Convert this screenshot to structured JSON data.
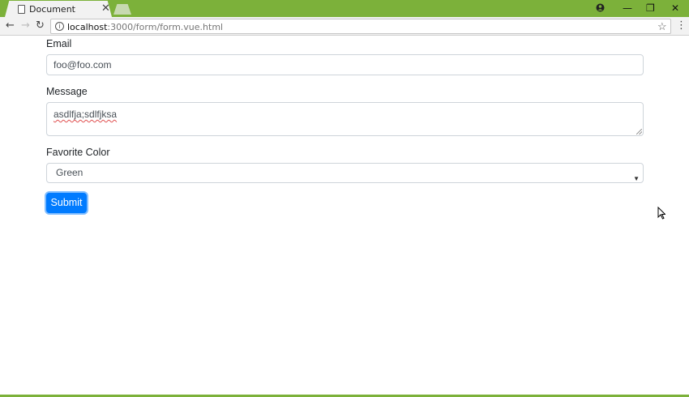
{
  "browser": {
    "tab_title": "Document",
    "tab_close": "✕",
    "url_host": "localhost",
    "url_path": ":3000/form/form.vue.html",
    "window_controls": {
      "minimize": "—",
      "maximize": "❐",
      "close": "✕"
    },
    "icons": {
      "back": "arrow-left-icon",
      "forward": "arrow-right-icon",
      "reload": "reload-icon",
      "info": "info-icon",
      "star": "star-icon",
      "menu": "kebab-menu-icon",
      "account": "account-icon"
    }
  },
  "form": {
    "email_label": "Email",
    "email_value": "foo@foo.com",
    "message_label": "Message",
    "message_value": "asdlfja;sdlfjksa",
    "color_label": "Favorite Color",
    "color_value": "Green",
    "submit_label": "Submit"
  },
  "colors": {
    "titlebar": "#7cb13a",
    "primary": "#007bff"
  }
}
